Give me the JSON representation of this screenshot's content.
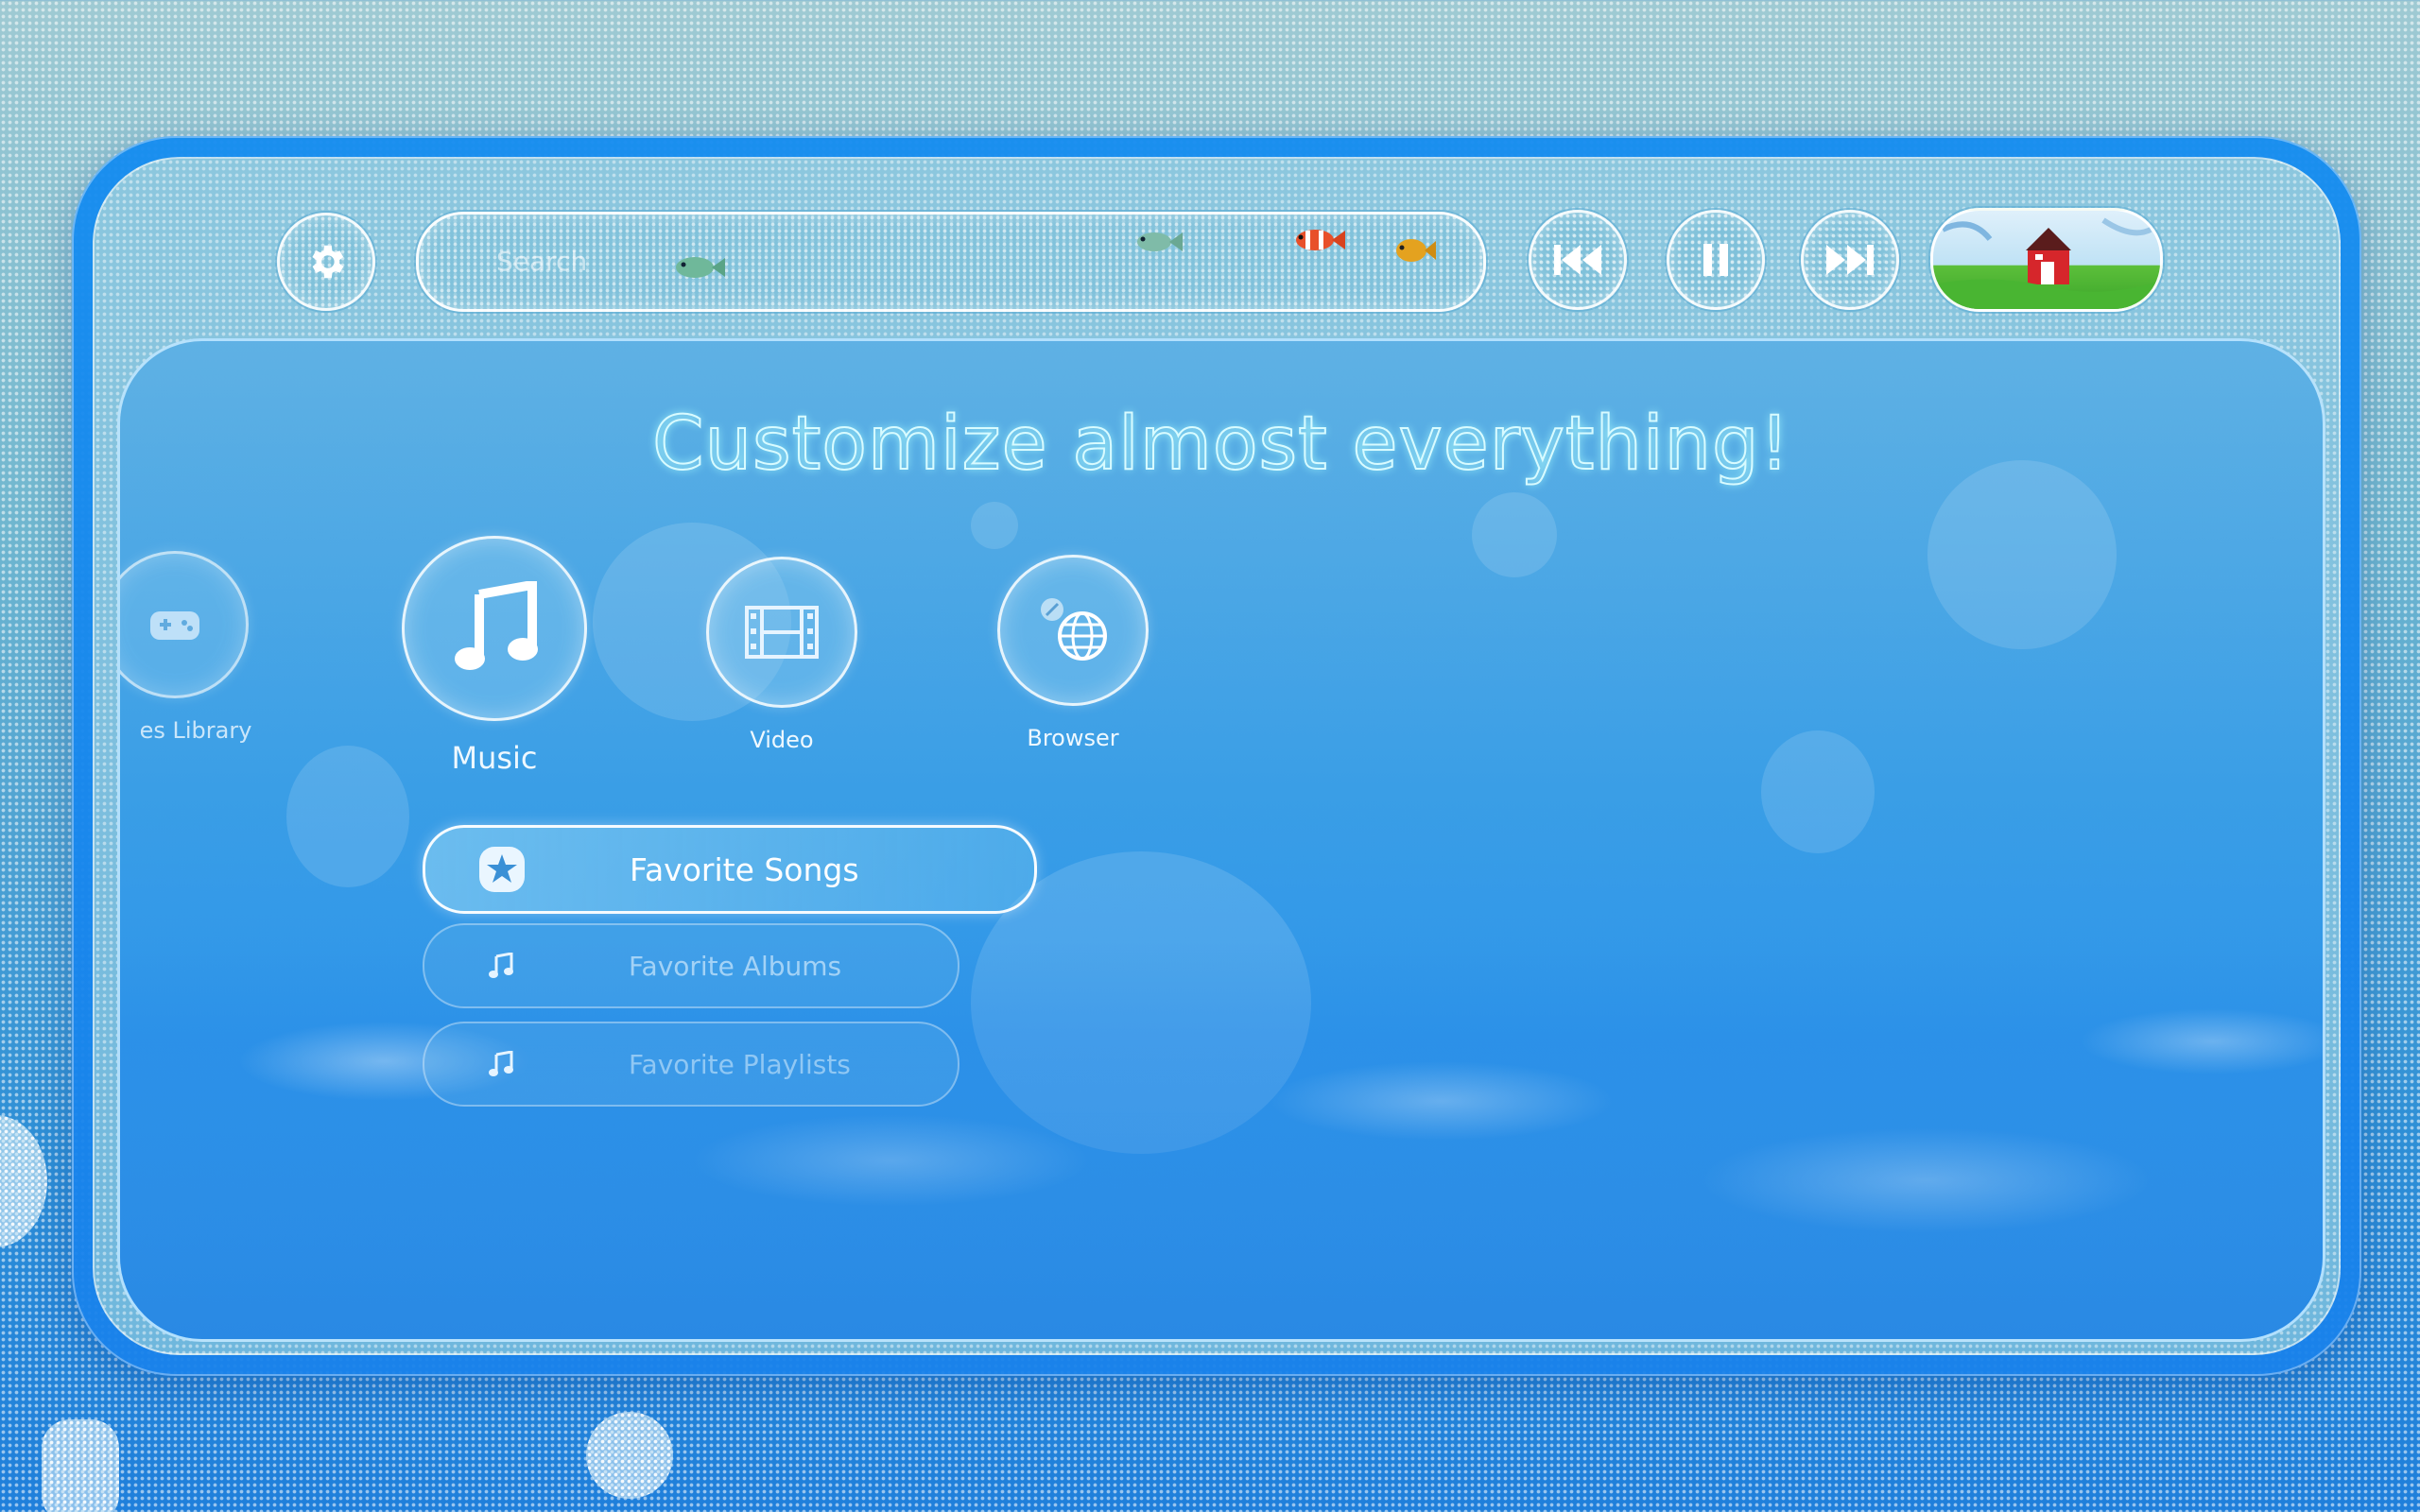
{
  "search": {
    "placeholder": "Search"
  },
  "toolbar": {
    "settings_icon": "gear-icon",
    "prev_icon": "skip-back-icon",
    "pause_icon": "pause-icon",
    "next_icon": "skip-forward-icon",
    "album_art_icon": "red-barn-album-art"
  },
  "main": {
    "headline": "Customize almost everything!",
    "categories": [
      {
        "label": "es Library",
        "icon": "gamepad-icon"
      },
      {
        "label": "Music",
        "icon": "music-note-icon"
      },
      {
        "label": "Video",
        "icon": "film-icon"
      },
      {
        "label": "Browser",
        "icon": "globe-icon"
      }
    ],
    "list": [
      {
        "label": "Favorite Songs",
        "icon": "star-icon",
        "selected": true
      },
      {
        "label": "Favorite Albums",
        "icon": "music-note-icon",
        "selected": false
      },
      {
        "label": "Favorite Playlists",
        "icon": "music-note-icon",
        "selected": false
      }
    ]
  },
  "colors": {
    "accent": "#1f8cf0",
    "headline_stroke": "#d8fbff",
    "text": "#eef8ff"
  }
}
